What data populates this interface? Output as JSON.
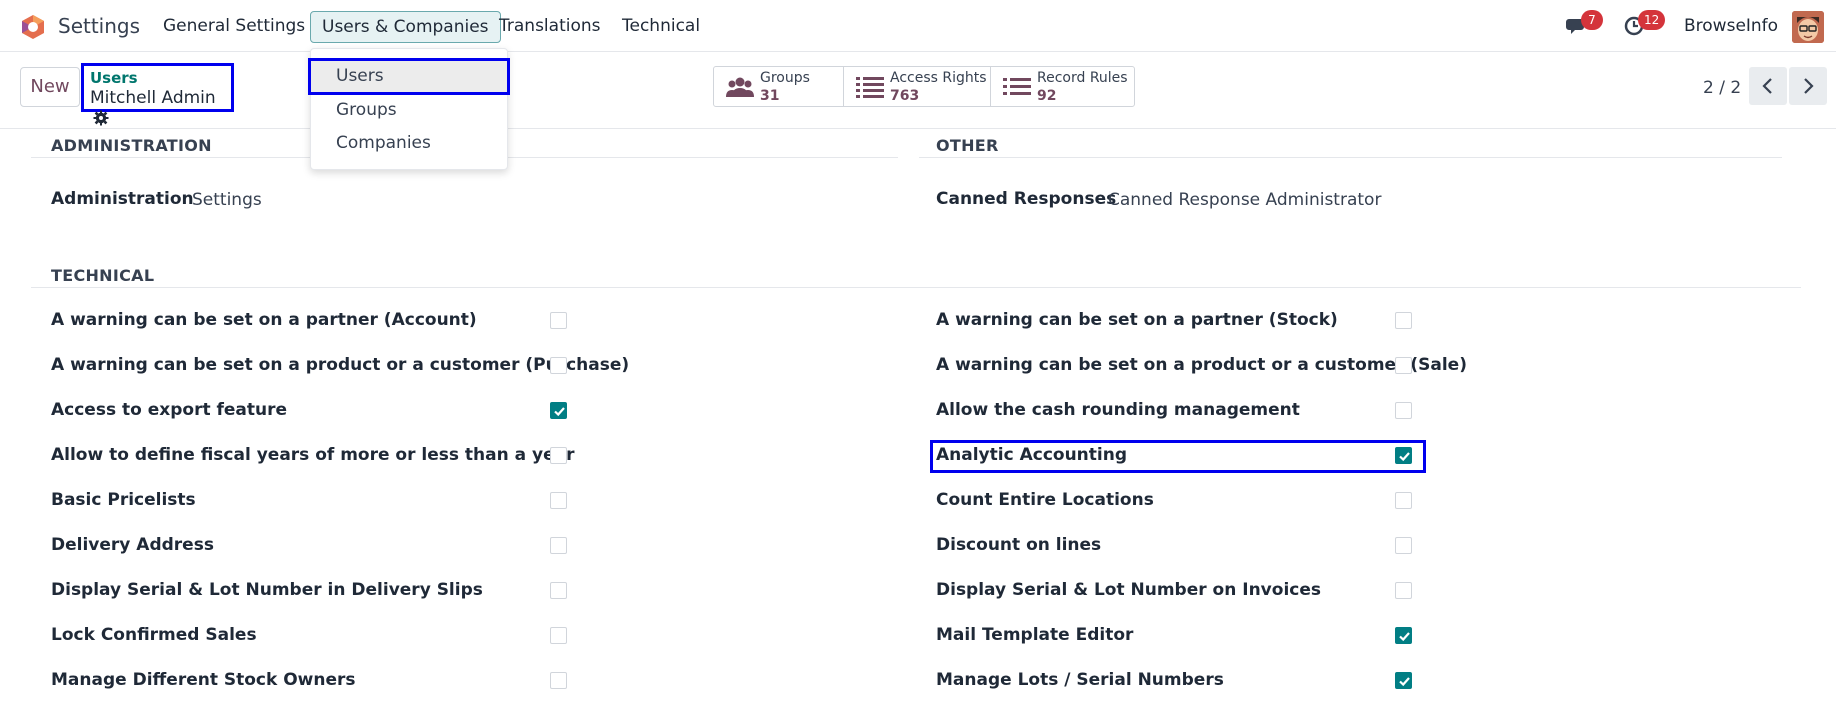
{
  "navbar": {
    "app_name": "Settings",
    "menu": [
      "General Settings",
      "Users & Companies",
      "Translations",
      "Technical"
    ],
    "active_menu": "Users & Companies",
    "messages_count": "7",
    "activities_count": "12",
    "company": "BrowseInfo",
    "brand_color": "#71485e",
    "accent_color": "#017e84"
  },
  "dropdown": {
    "items": [
      "Users",
      "Groups",
      "Companies"
    ],
    "highlighted": "Users"
  },
  "control": {
    "new_label": "New",
    "breadcrumb_parent": "Users",
    "breadcrumb_current": "Mitchell Admin",
    "smart_buttons": [
      {
        "label": "Groups",
        "count": "31",
        "icon": "users-icon"
      },
      {
        "label": "Access Rights",
        "count": "763",
        "icon": "list-icon"
      },
      {
        "label": "Record Rules",
        "count": "92",
        "icon": "list-icon"
      }
    ],
    "pager": "2 / 2"
  },
  "sections": {
    "administration": {
      "title": "ADMINISTRATION",
      "label": "Administration",
      "value": "Settings"
    },
    "other": {
      "title": "OTHER",
      "label": "Canned Responses",
      "value": "Canned Response Administrator"
    },
    "technical": {
      "title": "TECHNICAL",
      "left": [
        {
          "label": "A warning can be set on a partner (Account)",
          "checked": false
        },
        {
          "label": "A warning can be set on a product or a customer (Purchase)",
          "checked": false
        },
        {
          "label": "Access to export feature",
          "checked": true
        },
        {
          "label": "Allow to define fiscal years of more or less than a year",
          "checked": false
        },
        {
          "label": "Basic Pricelists",
          "checked": false
        },
        {
          "label": "Delivery Address",
          "checked": false
        },
        {
          "label": "Display Serial & Lot Number in Delivery Slips",
          "checked": false
        },
        {
          "label": "Lock Confirmed Sales",
          "checked": false
        },
        {
          "label": "Manage Different Stock Owners",
          "checked": false
        }
      ],
      "right": [
        {
          "label": "A warning can be set on a partner (Stock)",
          "checked": false
        },
        {
          "label": "A warning can be set on a product or a customer (Sale)",
          "checked": false
        },
        {
          "label": "Allow the cash rounding management",
          "checked": false
        },
        {
          "label": "Analytic Accounting",
          "checked": true
        },
        {
          "label": "Count Entire Locations",
          "checked": false
        },
        {
          "label": "Discount on lines",
          "checked": false
        },
        {
          "label": "Display Serial & Lot Number on Invoices",
          "checked": false
        },
        {
          "label": "Mail Template Editor",
          "checked": true
        },
        {
          "label": "Manage Lots / Serial Numbers",
          "checked": true
        }
      ]
    }
  }
}
